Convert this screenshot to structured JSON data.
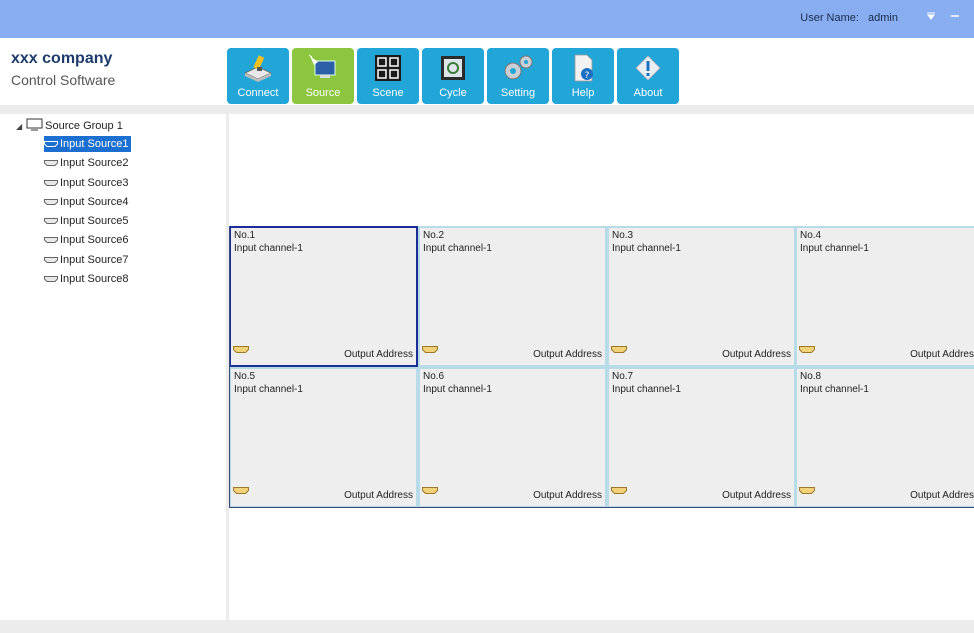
{
  "titlebar": {
    "user_label": "User Name:",
    "user_value": "admin",
    "menu_icon": "dropdown-icon",
    "min_icon": "minimize-icon"
  },
  "brand": {
    "title": "xxx company",
    "subtitle": "Control Software"
  },
  "toolbar": {
    "items": [
      {
        "label": "Connect",
        "icon": "connect-icon",
        "active": false
      },
      {
        "label": "Source",
        "icon": "source-icon",
        "active": true
      },
      {
        "label": "Scene",
        "icon": "scene-icon",
        "active": false
      },
      {
        "label": "Cycle",
        "icon": "cycle-icon",
        "active": false
      },
      {
        "label": "Setting",
        "icon": "gear-icon",
        "active": false
      },
      {
        "label": "Help",
        "icon": "help-icon",
        "active": false
      },
      {
        "label": "About",
        "icon": "info-icon",
        "active": false
      }
    ]
  },
  "tree": {
    "group_label": "Source Group 1",
    "items": [
      {
        "label": "Input Source1",
        "selected": true
      },
      {
        "label": "Input Source2",
        "selected": false
      },
      {
        "label": "Input Source3",
        "selected": false
      },
      {
        "label": "Input Source4",
        "selected": false
      },
      {
        "label": "Input Source5",
        "selected": false
      },
      {
        "label": "Input Source6",
        "selected": false
      },
      {
        "label": "Input Source7",
        "selected": false
      },
      {
        "label": "Input Source8",
        "selected": false
      }
    ]
  },
  "outputs": [
    {
      "num": "No.1",
      "channel": "Input channel-1",
      "addr": "Output Address",
      "selected": true
    },
    {
      "num": "No.2",
      "channel": "Input channel-1",
      "addr": "Output Address",
      "selected": false
    },
    {
      "num": "No.3",
      "channel": "Input channel-1",
      "addr": "Output Address",
      "selected": false
    },
    {
      "num": "No.4",
      "channel": "Input channel-1",
      "addr": "Output Address",
      "selected": false
    },
    {
      "num": "No.5",
      "channel": "Input channel-1",
      "addr": "Output Address",
      "selected": false
    },
    {
      "num": "No.6",
      "channel": "Input channel-1",
      "addr": "Output Address",
      "selected": false
    },
    {
      "num": "No.7",
      "channel": "Input channel-1",
      "addr": "Output Address",
      "selected": false
    },
    {
      "num": "No.8",
      "channel": "Input channel-1",
      "addr": "Output Address",
      "selected": false
    }
  ],
  "colors": {
    "titlebar": "#88aef1",
    "toolbar_button": "#22a5d7",
    "toolbar_active": "#8cc63f",
    "tree_selected": "#1a6fd0",
    "cell_border": "#b7dbe7",
    "cell_selected_border": "#1a2e96"
  }
}
